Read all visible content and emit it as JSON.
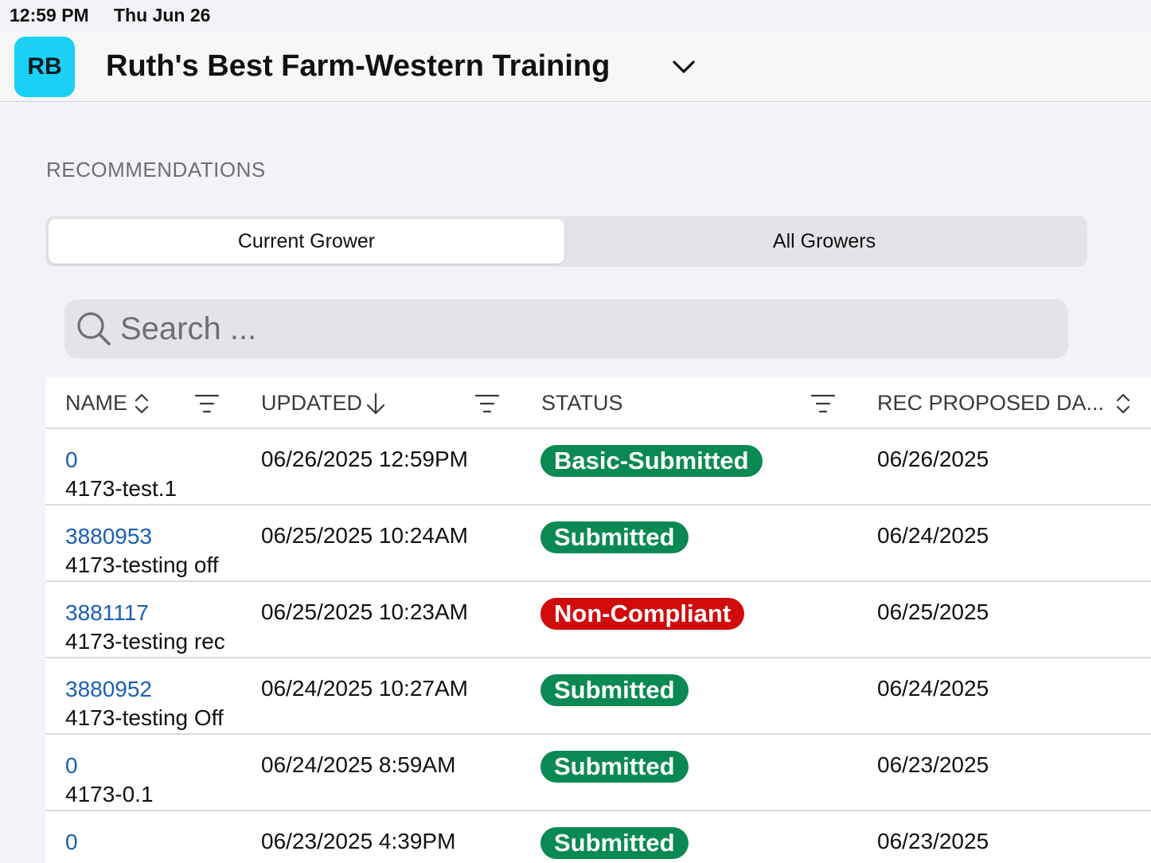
{
  "status_bar": {
    "time": "12:59 PM",
    "date": "Thu Jun 26"
  },
  "header": {
    "avatar_initials": "RB",
    "title": "Ruth's Best Farm-Western Training",
    "avatar_color": "#1ad1f5"
  },
  "section_title": "RECOMMENDATIONS",
  "segments": {
    "current": "Current Grower",
    "all": "All Growers",
    "selected": "Current Grower"
  },
  "search": {
    "placeholder": "Search ..."
  },
  "table": {
    "columns": {
      "name": "NAME",
      "updated": "UPDATED",
      "status": "STATUS",
      "rec_proposed_date": "REC PROPOSED DA..."
    },
    "rows": [
      {
        "id": "0",
        "name": "4173-test.1",
        "updated": "06/26/2025 12:59PM",
        "status": "Basic-Submitted",
        "status_color": "#0a8a52",
        "rec_proposed_date": "06/26/2025"
      },
      {
        "id": "3880953",
        "name": "4173-testing off",
        "updated": "06/25/2025 10:24AM",
        "status": "Submitted",
        "status_color": "#0a8a52",
        "rec_proposed_date": "06/24/2025"
      },
      {
        "id": "3881117",
        "name": "4173-testing rec",
        "updated": "06/25/2025 10:23AM",
        "status": "Non-Compliant",
        "status_color": "#d10a0a",
        "rec_proposed_date": "06/25/2025"
      },
      {
        "id": "3880952",
        "name": "4173-testing Off",
        "updated": "06/24/2025 10:27AM",
        "status": "Submitted",
        "status_color": "#0a8a52",
        "rec_proposed_date": "06/24/2025"
      },
      {
        "id": "0",
        "name": "4173-0.1",
        "updated": "06/24/2025 8:59AM",
        "status": "Submitted",
        "status_color": "#0a8a52",
        "rec_proposed_date": "06/23/2025"
      },
      {
        "id": "0",
        "name": "",
        "updated": "06/23/2025 4:39PM",
        "status": "Submitted",
        "status_color": "#0a8a52",
        "rec_proposed_date": "06/23/2025"
      }
    ]
  },
  "icons": {
    "chevron": "chevron-down-icon",
    "search": "search-icon",
    "sort_both": "sort-updown-icon",
    "sort_desc": "sort-desc-arrow-icon",
    "filter": "filter-icon"
  }
}
